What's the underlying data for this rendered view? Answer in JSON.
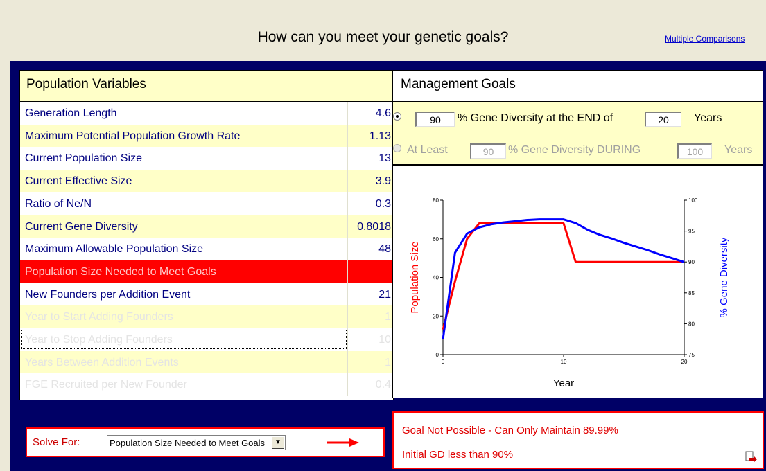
{
  "header": {
    "title": "How can you meet your genetic goals?",
    "link": "Multiple Comparisons"
  },
  "variables": {
    "header": "Population Variables",
    "rows": [
      {
        "label": "Generation Length",
        "value": "4.6"
      },
      {
        "label": "Maximum Potential Population Growth Rate",
        "value": "1.13"
      },
      {
        "label": "Current Population Size",
        "value": "13"
      },
      {
        "label": "Current Effective Size",
        "value": "3.9"
      },
      {
        "label": "Ratio of Ne/N",
        "value": "0.3"
      },
      {
        "label": "Current Gene Diversity",
        "value": "0.8018"
      },
      {
        "label": "Maximum Allowable Population Size",
        "value": "48"
      },
      {
        "label": "Population Size Needed to Meet Goals",
        "value": ""
      },
      {
        "label": "New Founders per Addition Event",
        "value": "21"
      },
      {
        "label": "Year to Start Adding Founders",
        "value": "1"
      },
      {
        "label": "Year to Stop Adding Founders",
        "value": "10"
      },
      {
        "label": "Years Between  Addition Events",
        "value": "1"
      },
      {
        "label": "FGE Recruited per New Founder",
        "value": "0.4"
      }
    ]
  },
  "goals": {
    "header": "Management Goals",
    "goal1": {
      "selected": true,
      "pct": "90",
      "text_mid": "% Gene Diversity at the END of",
      "years": "20",
      "text_end": "Years"
    },
    "goal2": {
      "selected": false,
      "prefix": "At Least",
      "pct": "90",
      "text_mid": "% Gene Diversity DURING",
      "years": "100",
      "text_end": "Years"
    }
  },
  "solve": {
    "label": "Solve For:",
    "selected": "Population Size Needed to Meet Goals"
  },
  "message": {
    "line1": "Goal Not Possible - Can Only Maintain 89.99%",
    "line2": "Initial GD less than 90%"
  },
  "chart_data": {
    "type": "line",
    "xlabel": "Year",
    "ylabel_left": "Population Size",
    "ylabel_right": "% Gene Diversity",
    "xlim": [
      0,
      20
    ],
    "ylim_left": [
      0,
      80
    ],
    "ylim_right": [
      75,
      100
    ],
    "x_ticks": [
      "0",
      "10",
      "20"
    ],
    "y_ticks_left": [
      "0",
      "20",
      "40",
      "60",
      "80"
    ],
    "y_ticks_right": [
      "75",
      "80",
      "85",
      "90",
      "95",
      "100"
    ],
    "series": [
      {
        "name": "Population Size",
        "axis": "left",
        "color": "#ff0000",
        "x": [
          0,
          1,
          2,
          3,
          4,
          5,
          6,
          7,
          8,
          9,
          10,
          11,
          12,
          13,
          14,
          15,
          16,
          17,
          18,
          19,
          20
        ],
        "y": [
          13,
          38,
          60,
          68,
          68,
          68,
          68,
          68,
          68,
          68,
          68,
          48,
          48,
          48,
          48,
          48,
          48,
          48,
          48,
          48,
          48
        ]
      },
      {
        "name": "% Gene Diversity",
        "axis": "right",
        "color": "#0000ff",
        "x": [
          0,
          1,
          2,
          3,
          4,
          5,
          6,
          7,
          8,
          9,
          10,
          11,
          12,
          13,
          14,
          15,
          16,
          17,
          18,
          19,
          20
        ],
        "y": [
          77.5,
          91.5,
          94.6,
          95.6,
          96.1,
          96.4,
          96.6,
          96.8,
          96.9,
          96.9,
          96.9,
          96.3,
          95.2,
          94.4,
          93.8,
          93.1,
          92.5,
          91.9,
          91.2,
          90.6,
          89.99
        ]
      }
    ]
  }
}
